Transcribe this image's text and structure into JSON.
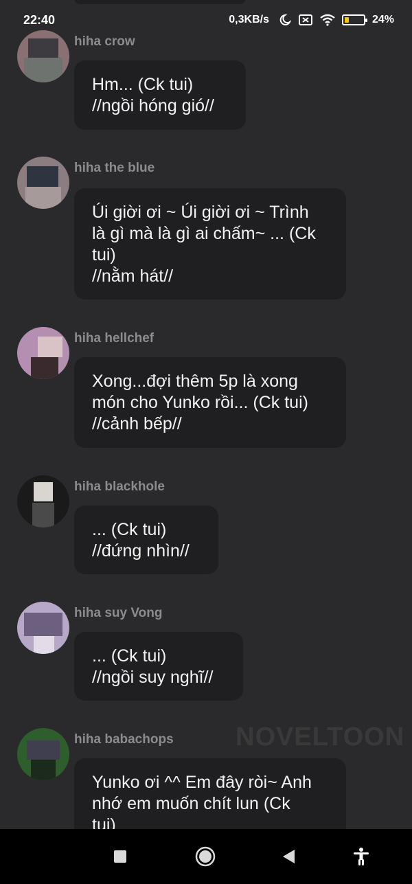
{
  "status_bar": {
    "time": "22:40",
    "net_speed": "0,3KB/s",
    "battery": "24%",
    "battery_level": 0.24,
    "battery_color": "#f5c518",
    "icons": [
      "moon-icon",
      "sim-off-icon",
      "wifi-icon",
      "battery-icon"
    ]
  },
  "messages": [
    {
      "name": "hiha crow",
      "lines": [
        "Hm... (Ck tui)",
        "//ngồi hóng gió//"
      ],
      "avatar_colors": [
        "#8a6f73",
        "#3d3b3f",
        "#6e7370"
      ]
    },
    {
      "name": "hiha the blue",
      "lines": [
        "Úi giời ơi ~ Úi giời ơi ~ Trình",
        "là gì mà là gì ai chấm~ ... (Ck",
        "tui)",
        "//nằm hát//"
      ],
      "avatar_colors": [
        "#8c7e80",
        "#2f3540",
        "#a69a9a"
      ]
    },
    {
      "name": "hiha hellchef",
      "lines": [
        "Xong...đợi thêm 5p là xong",
        "món cho Yunko rồi... (Ck tui)",
        "//cảnh bếp//"
      ],
      "avatar_colors": [
        "#b58fb2",
        "#d9c3c7",
        "#3a2a2d"
      ]
    },
    {
      "name": "hiha blackhole",
      "lines": [
        "... (Ck tui)",
        "//đứng nhìn//"
      ],
      "avatar_colors": [
        "#1a1a1a",
        "#d9d6d0",
        "#4a4a4a"
      ]
    },
    {
      "name": "hiha suy Vong",
      "lines": [
        "... (Ck tui)",
        "//ngồi suy nghĩ//"
      ],
      "avatar_colors": [
        "#b8a8c8",
        "#6d5f7e",
        "#e3dbe8"
      ]
    },
    {
      "name": "hiha babachops",
      "lines": [
        "Yunko ơi ^^ Em đây ròi~ Anh",
        "nhớ em muốn chít lun (Ck",
        "tui)"
      ],
      "avatar_colors": [
        "#2e5d2e",
        "#3f3f4f",
        "#1c2a1c"
      ]
    }
  ],
  "watermark": "NOVELTOON",
  "nav_bar": {
    "buttons": [
      "recents-button",
      "home-button",
      "back-button",
      "accessibility-button"
    ]
  }
}
